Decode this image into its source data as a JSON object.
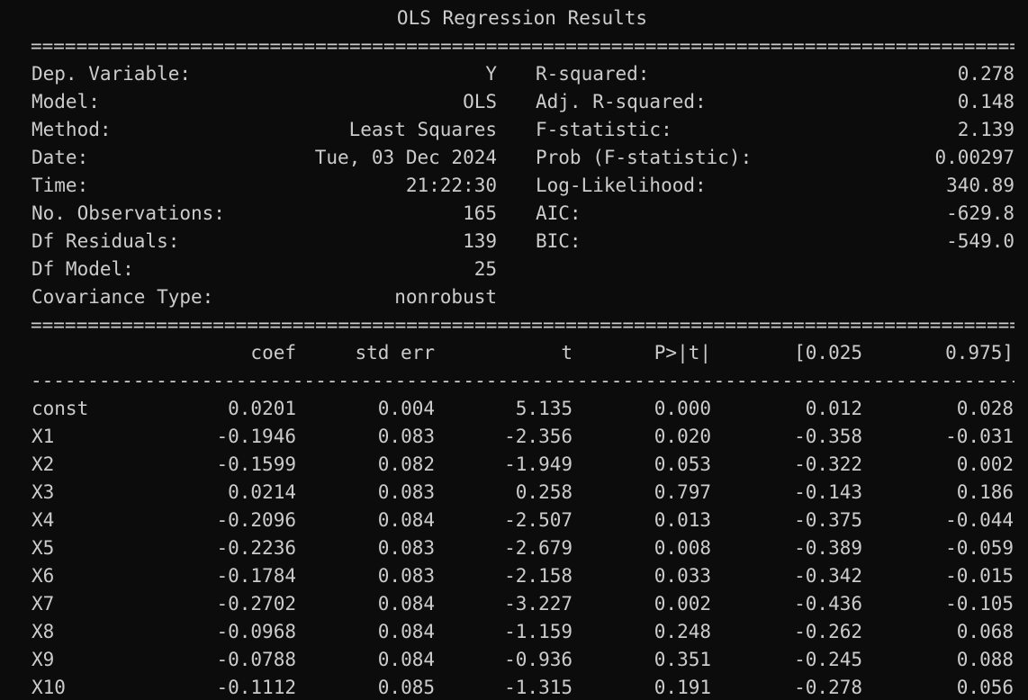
{
  "cut_top_line": {
    "pre": "                                         ",
    "highlight": "  ",
    "post": ""
  },
  "title": "OLS Regression Results",
  "rule_double": "==============================================================================================================",
  "rule_single": "--------------------------------------------------------------------------------------------------------------",
  "summary_left": [
    {
      "label": "Dep. Variable:",
      "value": "Y"
    },
    {
      "label": "Model:",
      "value": "OLS"
    },
    {
      "label": "Method:",
      "value": "Least Squares"
    },
    {
      "label": "Date:",
      "value": "Tue, 03 Dec 2024"
    },
    {
      "label": "Time:",
      "value": "21:22:30"
    },
    {
      "label": "No. Observations:",
      "value": "165"
    },
    {
      "label": "Df Residuals:",
      "value": "139"
    },
    {
      "label": "Df Model:",
      "value": "25"
    },
    {
      "label": "Covariance Type:",
      "value": "nonrobust"
    }
  ],
  "summary_right": [
    {
      "label": "R-squared:",
      "value": "0.278"
    },
    {
      "label": "Adj. R-squared:",
      "value": "0.148"
    },
    {
      "label": "F-statistic:",
      "value": "2.139"
    },
    {
      "label": "Prob (F-statistic):",
      "value": "0.00297"
    },
    {
      "label": "Log-Likelihood:",
      "value": "340.89"
    },
    {
      "label": "AIC:",
      "value": "-629.8"
    },
    {
      "label": "BIC:",
      "value": "-549.0"
    }
  ],
  "coef_headers": [
    "coef",
    "std err",
    "t",
    "P>|t|",
    "[0.025",
    "0.975]"
  ],
  "coef_rows": [
    {
      "name": "const",
      "cells": [
        "0.0201",
        "0.004",
        "5.135",
        "0.000",
        "0.012",
        "0.028"
      ]
    },
    {
      "name": "X1",
      "cells": [
        "-0.1946",
        "0.083",
        "-2.356",
        "0.020",
        "-0.358",
        "-0.031"
      ]
    },
    {
      "name": "X2",
      "cells": [
        "-0.1599",
        "0.082",
        "-1.949",
        "0.053",
        "-0.322",
        "0.002"
      ]
    },
    {
      "name": "X3",
      "cells": [
        "0.0214",
        "0.083",
        "0.258",
        "0.797",
        "-0.143",
        "0.186"
      ]
    },
    {
      "name": "X4",
      "cells": [
        "-0.2096",
        "0.084",
        "-2.507",
        "0.013",
        "-0.375",
        "-0.044"
      ]
    },
    {
      "name": "X5",
      "cells": [
        "-0.2236",
        "0.083",
        "-2.679",
        "0.008",
        "-0.389",
        "-0.059"
      ]
    },
    {
      "name": "X6",
      "cells": [
        "-0.1784",
        "0.083",
        "-2.158",
        "0.033",
        "-0.342",
        "-0.015"
      ]
    },
    {
      "name": "X7",
      "cells": [
        "-0.2702",
        "0.084",
        "-3.227",
        "0.002",
        "-0.436",
        "-0.105"
      ]
    },
    {
      "name": "X8",
      "cells": [
        "-0.0968",
        "0.084",
        "-1.159",
        "0.248",
        "-0.262",
        "0.068"
      ]
    },
    {
      "name": "X9",
      "cells": [
        "-0.0788",
        "0.084",
        "-0.936",
        "0.351",
        "-0.245",
        "0.088"
      ]
    },
    {
      "name": "X10",
      "cells": [
        "-0.1112",
        "0.085",
        "-1.315",
        "0.191",
        "-0.278",
        "0.056"
      ]
    }
  ],
  "colors": {
    "background": "#0c0c0c",
    "text": "#cccccc",
    "highlight": "#f9f1a5"
  }
}
